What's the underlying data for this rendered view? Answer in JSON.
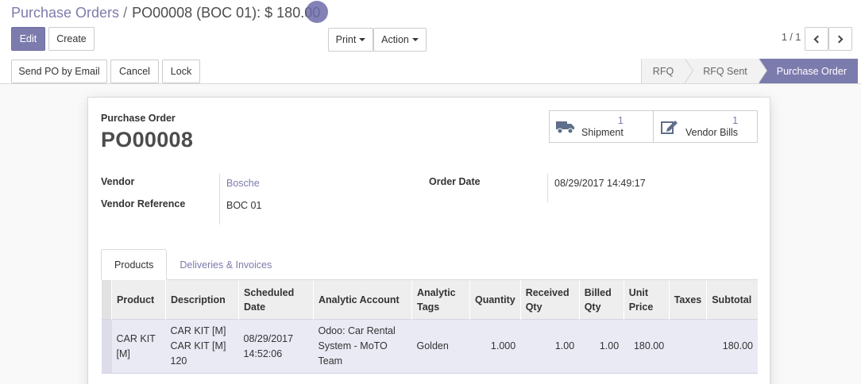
{
  "breadcrumb": {
    "parent": "Purchase Orders",
    "separator": "/",
    "current": "PO00008 (BOC 01): $ 180.00"
  },
  "toolbar": {
    "edit_label": "Edit",
    "create_label": "Create",
    "print_label": "Print",
    "action_label": "Action",
    "pager_value": "1 / 1"
  },
  "statusbar": {
    "send_email_label": "Send PO by Email",
    "cancel_label": "Cancel",
    "lock_label": "Lock",
    "stages": [
      "RFQ",
      "RFQ Sent",
      "Purchase Order"
    ],
    "active_stage": "Purchase Order"
  },
  "sheet": {
    "doc_label": "Purchase Order",
    "doc_name": "PO00008",
    "smart_buttons": [
      {
        "count": "1",
        "label": "Shipment",
        "icon": "truck-icon"
      },
      {
        "count": "1",
        "label": "Vendor Bills",
        "icon": "edit-icon"
      }
    ],
    "fields": {
      "vendor_label": "Vendor",
      "vendor_value": "Bosche",
      "vendor_ref_label": "Vendor Reference",
      "vendor_ref_value": "BOC 01",
      "order_date_label": "Order Date",
      "order_date_value": "08/29/2017 14:49:17"
    },
    "tabs": [
      "Products",
      "Deliveries & Invoices"
    ],
    "table": {
      "headers": [
        "Product",
        "Description",
        "Scheduled Date",
        "Analytic Account",
        "Analytic Tags",
        "Quantity",
        "Received Qty",
        "Billed Qty",
        "Unit Price",
        "Taxes",
        "Subtotal"
      ],
      "header_lines": {
        "scheduled_1": "Scheduled",
        "scheduled_2": "Date",
        "tags_1": "Analytic",
        "tags_2": "Tags",
        "received_1": "Received",
        "received_2": "Qty",
        "billed_1": "Billed",
        "billed_2": "Qty",
        "unit_1": "Unit",
        "unit_2": "Price"
      },
      "row": {
        "product_1": "CAR KIT",
        "product_2": "[M]",
        "description_1": "CAR KIT [M]",
        "description_2": "CAR KIT [M]",
        "description_3": "120",
        "date_1": "08/29/2017",
        "date_2": "14:52:06",
        "account_1": "Odoo: Car Rental",
        "account_2": "System - MoTO",
        "account_3": "Team",
        "tags": "Golden",
        "quantity": "1.000",
        "received": "1.00",
        "billed": "1.00",
        "unit_price": "180.00",
        "taxes": "",
        "subtotal": "180.00"
      }
    }
  },
  "colors": {
    "brand": "#7c7bad",
    "row_highlight": "#e9eaf4"
  }
}
